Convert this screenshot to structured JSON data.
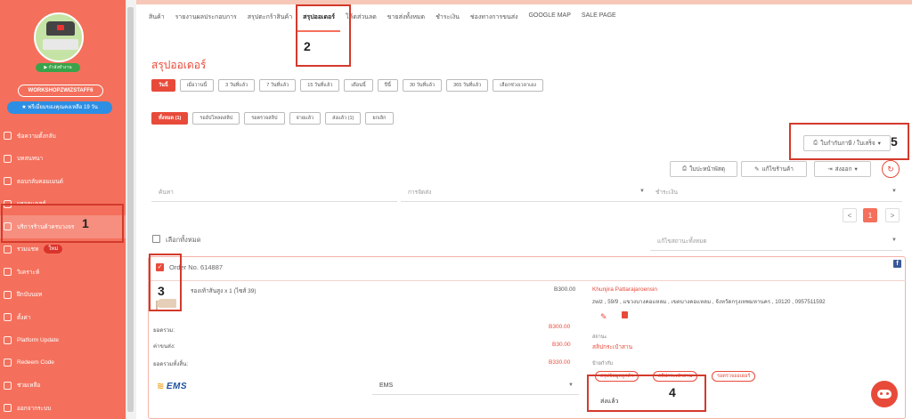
{
  "sidebar": {
    "status": "กำลังทำงาน",
    "shop_name": "WORKSHOPZWIZSTAFF6",
    "premium": "พรีเมี่ยมของคุณคงเหลือ 19 วัน",
    "items": [
      {
        "label": "ข้อความตั้งกลับ",
        "icon": "message-icon"
      },
      {
        "label": "บทสนทนา",
        "icon": "chat-icon"
      },
      {
        "label": "ตอบกลับคอมเมนต์",
        "icon": "comment-icon"
      },
      {
        "label": "บรอดแคสต์",
        "icon": "broadcast-icon"
      },
      {
        "label": "บริการร้านค้าครบวงจร",
        "icon": "shop-icon"
      },
      {
        "label": "รวมแชท",
        "icon": "group-chat-icon",
        "badge": "ใหม่"
      },
      {
        "label": "วิเคราะห์",
        "icon": "analytics-icon"
      },
      {
        "label": "ฝึกบับบอท",
        "icon": "bot-icon"
      },
      {
        "label": "ตั้งค่า",
        "icon": "gear-icon"
      },
      {
        "label": "Platform Update",
        "icon": "update-icon"
      },
      {
        "label": "Redeem Code",
        "icon": "tag-icon"
      },
      {
        "label": "ช่วยเหลือ",
        "icon": "help-icon"
      },
      {
        "label": "ออกจากระบบ",
        "icon": "logout-icon"
      }
    ]
  },
  "topnav": {
    "tabs": [
      "สินค้า",
      "รายงานผลประกอบการ",
      "สรุปตะกร้าสินค้า",
      "สรุปออเดอร์",
      "โค้ดส่วนลด",
      "ขายส่งทั้งหมด",
      "ชำระเงิน",
      "ช่องทางการขนส่ง",
      "GOOGLE MAP",
      "SALE PAGE"
    ],
    "active_index": 3
  },
  "page": {
    "title": "สรุปออเดอร์"
  },
  "date_filters": [
    "วันนี้",
    "เมื่อวานนี้",
    "3 วันที่แล้ว",
    "7 วันที่แล้ว",
    "15 วันที่แล้ว",
    "เดือนนี้",
    "ปีนี้",
    "30 วันที่แล้ว",
    "365 วันที่แล้ว",
    "เลือกช่วงเวลาเอง"
  ],
  "status_filters": [
    "ทั้งหมด (1)",
    "รออัปโหลดสลิป",
    "รอตรวจสลิป",
    "จ่ายแล้ว",
    "ส่งแล้ว (1)",
    "ยกเลิก"
  ],
  "actions": {
    "invoice": "ใบกำกับภาษี / ใบเสร็จ",
    "print_label": "ใบปะหน้าพัสดุ",
    "edit_shop": "แก้ไขร้านค้า",
    "export": "ส่งออก"
  },
  "search": {
    "placeholder": "ค้นหา",
    "shipping_placeholder": "การจัดส่ง",
    "payment_placeholder": "ชำระเงิน"
  },
  "pagination": {
    "current": "1",
    "prev": "<",
    "next": ">"
  },
  "bulk": {
    "select_all": "เลือกทั้งหมด",
    "bulk_status": "แก้ไขสถานะทั้งหมด"
  },
  "order": {
    "number": "Order No. 614887",
    "item": "รองเท้าส้นสูง x 1 (ไซส์ 39)",
    "item_price": "B300.00",
    "subtotal_label": "ยอดรวม:",
    "subtotal": "B300.00",
    "shipping_label": "ค่าขนส่ง:",
    "shipping": "B30.00",
    "total_label": "ยอดรวมทั้งสิ้น:",
    "total": "B330.00",
    "customer_name": "Khunjira Pattarajaroensin",
    "address": "zwiz , 59/9 , แขวงบางคอแหลม , เขตบางคอแหลม , จังหวัดกรุงเทพมหานคร , 10120 , 0957511592",
    "status_label": "สถานะ",
    "status_value": "สลิปกระเป๋าสาน",
    "tag_label": "ป้ายกำกับ",
    "tags": [
      "สรุปข้อมูลลูกค้า",
      "สลิปกระเป๋าสาน",
      "รอตรวจออเดอร์"
    ],
    "carrier_name": "EMS",
    "carrier_option": "EMS",
    "shipment_status": "ส่งแล้ว"
  },
  "annotations": [
    "1",
    "2",
    "3",
    "4",
    "5"
  ]
}
